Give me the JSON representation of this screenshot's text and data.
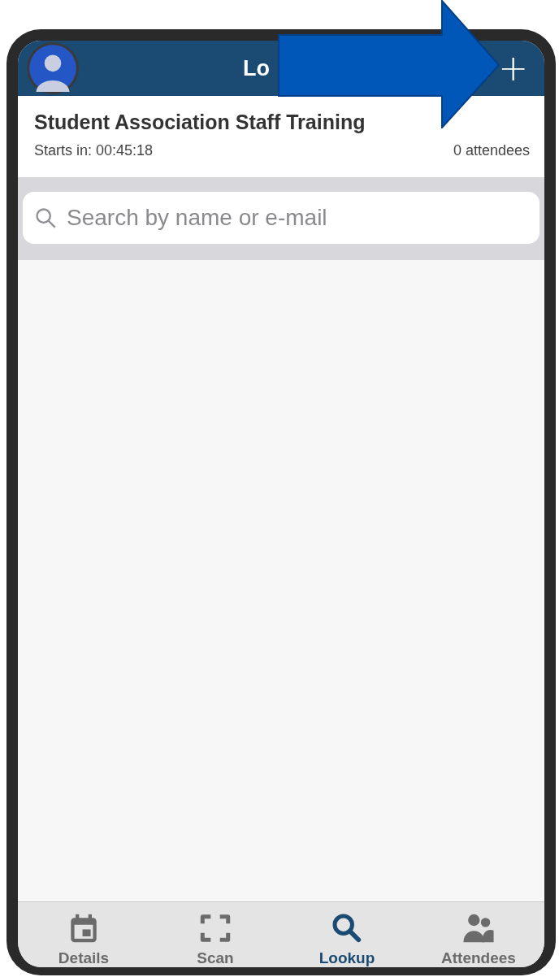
{
  "header": {
    "title": "Lo",
    "add_button": "+"
  },
  "event": {
    "name": "Student Association Staff Training",
    "countdown": "Starts in: 00:45:18",
    "attendees": "0 attendees"
  },
  "search": {
    "placeholder": "Search by name or e-mail"
  },
  "tabs": [
    {
      "kind": "calendar",
      "label": "Details",
      "selected": false
    },
    {
      "kind": "scan",
      "label": "Scan",
      "selected": false
    },
    {
      "kind": "search",
      "label": "Lookup",
      "selected": true
    },
    {
      "kind": "people",
      "label": "Attendees",
      "selected": false
    }
  ]
}
